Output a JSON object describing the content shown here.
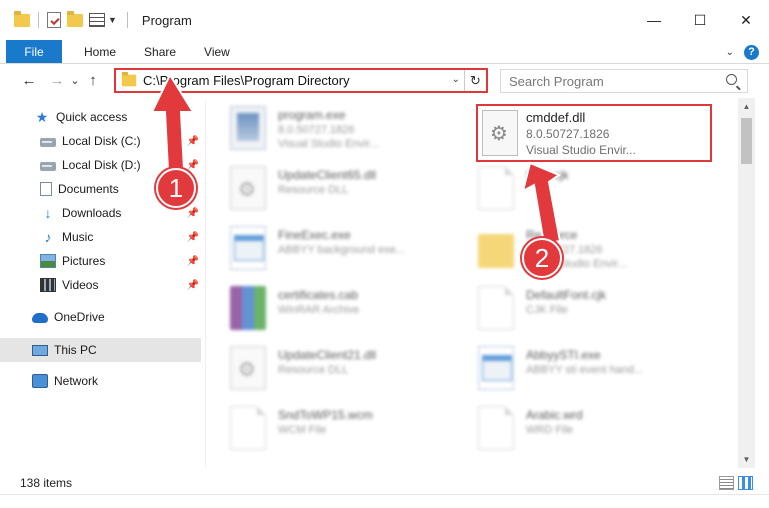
{
  "window": {
    "title": "Program",
    "controls": {
      "minimize": "—",
      "maximize": "☐",
      "close": "✕"
    }
  },
  "ribbon": {
    "file_tab": "File",
    "tabs": [
      "Home",
      "Share",
      "View"
    ],
    "help": "?"
  },
  "nav": {
    "back": "←",
    "forward": "→",
    "recent": "⌄",
    "up": "↑",
    "address": "C:\\Program Files\\Program Directory",
    "address_dropdown": "⌄",
    "refresh": "↻",
    "search_placeholder": "Search Program"
  },
  "sidebar": {
    "items": [
      {
        "label": "Quick access",
        "icon": "star-icon"
      },
      {
        "label": "Local Disk (C:)",
        "icon": "drive-icon",
        "pinned": true
      },
      {
        "label": "Local Disk (D:)",
        "icon": "drive-icon",
        "pinned": true
      },
      {
        "label": "Documents",
        "icon": "documents-icon",
        "pinned": true
      },
      {
        "label": "Downloads",
        "icon": "download-icon",
        "pinned": true
      },
      {
        "label": "Music",
        "icon": "music-icon",
        "pinned": true
      },
      {
        "label": "Pictures",
        "icon": "pictures-icon",
        "pinned": true
      },
      {
        "label": "Videos",
        "icon": "videos-icon",
        "pinned": true
      },
      {
        "label": "OneDrive",
        "icon": "cloud-icon"
      },
      {
        "label": "This PC",
        "icon": "computer-icon",
        "selected": true
      },
      {
        "label": "Network",
        "icon": "network-icon"
      }
    ],
    "pin_glyph": "📌"
  },
  "files": [
    {
      "name": "program.exe",
      "line1": "8.0.50727.1826",
      "line2": "Visual Studio Envir...",
      "icon": "program-icon"
    },
    {
      "name": "cmddef.dll",
      "line1": "8.0.50727.1826",
      "line2": "Visual Studio Envir...",
      "icon": "gear-file-icon",
      "highlighted": true
    },
    {
      "name": "UpdateClient65.dll",
      "line1": "Resource DLL",
      "line2": "",
      "icon": "gear-file-icon"
    },
    {
      "name": "Html.cjk",
      "line1": "",
      "line2": "",
      "icon": "blank-file-icon"
    },
    {
      "name": "FineExec.exe",
      "line1": "ABBYY background exe...",
      "line2": "",
      "icon": "app-window-icon"
    },
    {
      "name": "Resource",
      "line1": "8.0.50727.1826",
      "line2": "Visual Studio Envir...",
      "icon": "folder-icon"
    },
    {
      "name": "certificates.cab",
      "line1": "WinRAR Archive",
      "line2": "",
      "icon": "rar-archive-icon"
    },
    {
      "name": "DefaultFont.cjk",
      "line1": "CJK File",
      "line2": "",
      "icon": "blank-file-icon"
    },
    {
      "name": "UpdateClient21.dll",
      "line1": "Resource DLL",
      "line2": "",
      "icon": "gear-file-icon"
    },
    {
      "name": "AbbyySTI.exe",
      "line1": "ABBYY sti event hand...",
      "line2": "",
      "icon": "app-window-icon"
    },
    {
      "name": "SndToWP15.wcm",
      "line1": "WCM File",
      "line2": "",
      "icon": "blank-file-icon"
    },
    {
      "name": "Arabic.wrd",
      "line1": "WRD File",
      "line2": "",
      "icon": "blank-file-icon"
    }
  ],
  "status": {
    "item_count": "138 items"
  },
  "annotations": {
    "step1": "1",
    "step2": "2",
    "color": "#e2393d"
  },
  "colors": {
    "accent": "#1979ca",
    "highlight": "#e0373a"
  }
}
